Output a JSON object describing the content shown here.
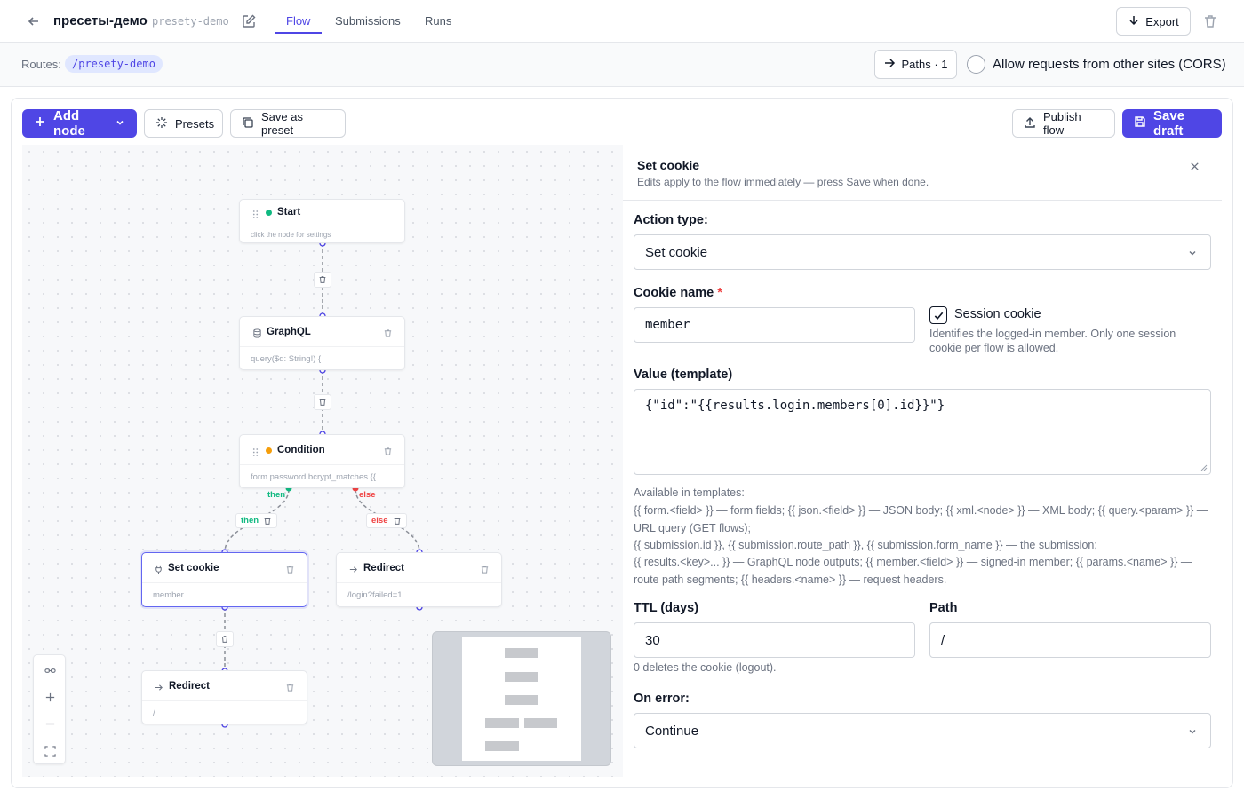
{
  "header": {
    "title": "пресеты-демо",
    "slug": "presety-demo",
    "tabs": [
      "Flow",
      "Submissions",
      "Runs"
    ],
    "active_tab": "Flow",
    "export_label": "Export"
  },
  "routes": {
    "label": "Routes:",
    "route": "/presety-demo",
    "paths_label": "Paths · 1",
    "cors_label": "Allow requests from other sites (CORS)",
    "cors_enabled": false
  },
  "toolbar": {
    "add_node": "Add node",
    "presets": "Presets",
    "save_as_preset": "Save as preset",
    "publish_flow": "Publish flow",
    "save_draft": "Save draft"
  },
  "nodes": {
    "start": {
      "title": "Start",
      "subtitle": "click the node for settings"
    },
    "graphql": {
      "title": "GraphQL",
      "subtitle": "query($q: String!) {"
    },
    "condition": {
      "title": "Condition",
      "subtitle": "form.password bcrypt_matches {{..."
    },
    "set_cookie": {
      "title": "Set cookie",
      "subtitle": "member"
    },
    "redirect_fail": {
      "title": "Redirect",
      "subtitle": "/login?failed=1"
    },
    "redirect_end": {
      "title": "Redirect",
      "subtitle": "/"
    }
  },
  "edges": {
    "then": "then",
    "else": "else"
  },
  "panel": {
    "title": "Set cookie",
    "subtitle": "Edits apply to the flow immediately — press Save when done.",
    "action_type_label": "Action type:",
    "action_type_value": "Set cookie",
    "cookie_name_label": "Cookie name",
    "cookie_name_required": "*",
    "cookie_name_value": "member",
    "session_cookie_label": "Session cookie",
    "session_cookie_checked": true,
    "session_cookie_hint": "Identifies the logged-in member. Only one session cookie per flow is allowed.",
    "value_label": "Value (template)",
    "value_template": "{\"id\":\"{{results.login.members[0].id}}\"}",
    "templates_help_title": "Available in templates:",
    "templates_help_lines": [
      "{{ form.<field> }} — form fields; {{ json.<field> }} — JSON body; {{ xml.<node> }} — XML body; {{ query.<param> }} — URL query (GET flows);",
      "{{ submission.id }}, {{ submission.route_path }}, {{ submission.form_name }} — the submission;",
      "{{ results.<key>... }} — GraphQL node outputs; {{ member.<field> }} — signed-in member; {{ params.<name> }} — route path segments; {{ headers.<name> }} — request headers."
    ],
    "ttl_label": "TTL (days)",
    "ttl_value": "30",
    "ttl_hint": "0 deletes the cookie (logout).",
    "path_label": "Path",
    "path_value": "/",
    "on_error_label": "On error:",
    "on_error_value": "Continue"
  },
  "colors": {
    "accent": "#4f46e5",
    "then": "#10b981",
    "else": "#ef4444",
    "start_dot": "#10b981",
    "condition_dot": "#f59e0b"
  }
}
